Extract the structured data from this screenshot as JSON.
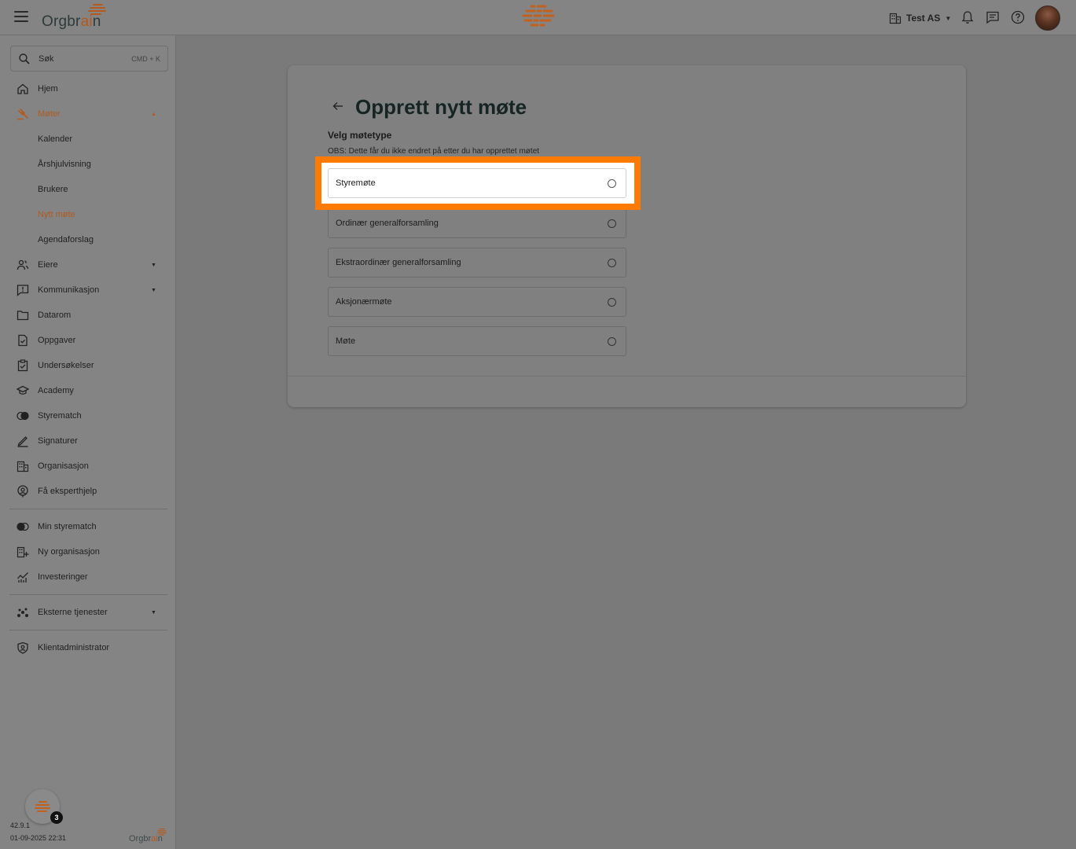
{
  "header": {
    "logo_prefix": "Orgbr",
    "logo_accent": "ai",
    "logo_suffix": "n",
    "org_name": "Test AS",
    "icons": [
      "menu-icon",
      "building-icon",
      "bell-icon",
      "chat-icon",
      "help-icon"
    ]
  },
  "sidebar": {
    "search_label": "Søk",
    "search_shortcut": "CMD + K",
    "items": [
      {
        "label": "Hjem",
        "icon": "home-icon"
      },
      {
        "label": "Møter",
        "icon": "gavel-icon",
        "active": true,
        "expanded": true
      },
      {
        "label": "Kalender",
        "sub": true
      },
      {
        "label": "Årshjulvisning",
        "sub": true
      },
      {
        "label": "Brukere",
        "sub": true
      },
      {
        "label": "Nytt møte",
        "sub": true,
        "active": true
      },
      {
        "label": "Agendaforslag",
        "sub": true
      },
      {
        "label": "Eiere",
        "icon": "people-icon",
        "expandable": true
      },
      {
        "label": "Kommunikasjon",
        "icon": "announcement-icon",
        "expandable": true
      },
      {
        "label": "Datarom",
        "icon": "folder-icon"
      },
      {
        "label": "Oppgaver",
        "icon": "task-icon"
      },
      {
        "label": "Undersøkelser",
        "icon": "clipboard-icon"
      },
      {
        "label": "Academy",
        "icon": "graduation-icon"
      },
      {
        "label": "Styrematch",
        "icon": "match-icon"
      },
      {
        "label": "Signaturer",
        "icon": "pen-icon"
      },
      {
        "label": "Organisasjon",
        "icon": "building-icon"
      },
      {
        "label": "Få eksperthjelp",
        "icon": "expert-icon"
      }
    ],
    "items2": [
      {
        "label": "Min styrematch",
        "icon": "match-icon"
      },
      {
        "label": "Ny organisasjon",
        "icon": "building-add-icon"
      },
      {
        "label": "Investeringer",
        "icon": "chart-icon"
      }
    ],
    "items3": [
      {
        "label": "Eksterne tjenester",
        "icon": "services-icon",
        "expandable": true
      }
    ],
    "items4": [
      {
        "label": "Klientadministrator",
        "icon": "shield-icon"
      }
    ],
    "help_badge": "3",
    "version": "42.9.1",
    "build_date": "01-09-2025 22:31",
    "footer_logo_prefix": "Orgbr",
    "footer_logo_accent": "ai",
    "footer_logo_suffix": "n"
  },
  "main": {
    "title": "Opprett nytt møte",
    "subtitle": "Velg møtetype",
    "note": "OBS: Dette får du ikke endret på etter du har opprettet møtet",
    "options": [
      {
        "label": "Styremøte",
        "highlighted": true
      },
      {
        "label": "Ordinær generalforsamling"
      },
      {
        "label": "Ekstraordinær generalforsamling"
      },
      {
        "label": "Aksjonærmøte"
      },
      {
        "label": "Møte"
      }
    ]
  },
  "colors": {
    "accent": "#b25a1f",
    "highlight": "#ff7a00"
  }
}
